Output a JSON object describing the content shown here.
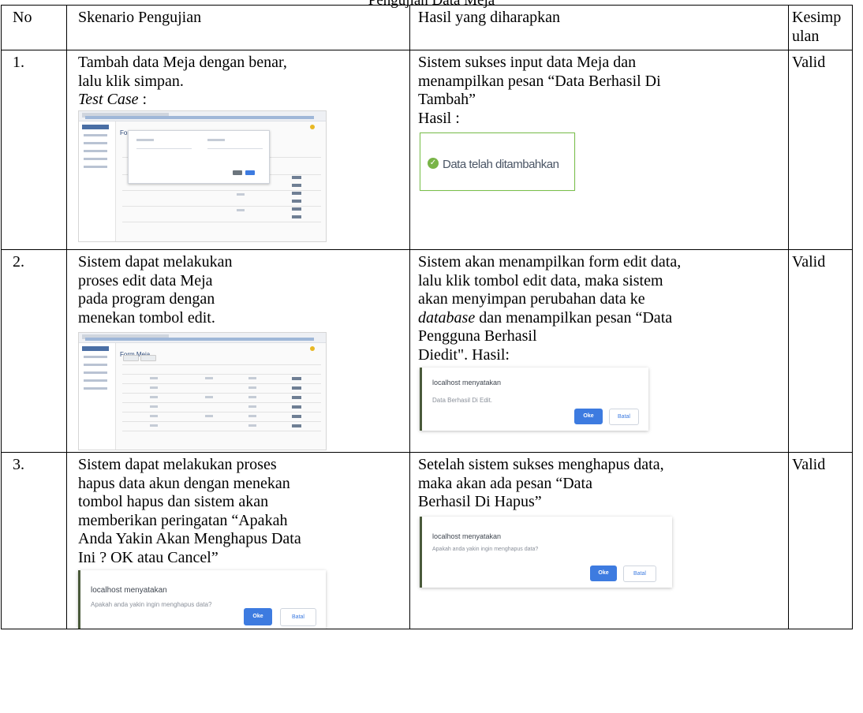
{
  "caption": "Pengujian Data Meja",
  "headers": {
    "no": "No",
    "skenario": "Skenario Pengujian",
    "hasil": "Hasil yang diharapkan",
    "kesimpulan_1": "Kesimp",
    "kesimpulan_2": "ulan"
  },
  "rows": [
    {
      "no": "1.",
      "skenario_lines": [
        "Tambah data Meja dengan benar,",
        "lalu klik simpan."
      ],
      "test_case_label": "Test Case",
      "test_case_suffix": " :",
      "hasil_lines": [
        "Sistem sukses input data Meja dan",
        "menampilkan pesan “Data Berhasil Di",
        "Tambah”",
        "Hasil :"
      ],
      "success_message": "Data telah ditambahkan",
      "screenshot_title": "Form Meja",
      "kesimpulan": "Valid"
    },
    {
      "no": "2.",
      "skenario_lines": [
        "Sistem dapat melakukan",
        "proses edit data Meja",
        "pada program dengan",
        "menekan tombol edit."
      ],
      "hasil_line1": "Sistem akan menampilkan form edit data,",
      "hasil_line2": "lalu klik tombol edit data, maka sistem",
      "hasil_line3": "akan menyimpan perubahan data ke",
      "hasil_db_word": "database",
      "hasil_line4_rest": " dan menampilkan pesan “Data",
      "hasil_line5": "Pengguna Berhasil",
      "hasil_line6": "Diedit\". Hasil:",
      "alert_title": "localhost menyatakan",
      "alert_message": "Data Berhasil Di Edit.",
      "alert_ok": "Oke",
      "alert_cancel": "Batal",
      "screenshot_title": "Form Meja",
      "kesimpulan": "Valid"
    },
    {
      "no": "3.",
      "skenario_lines": [
        "Sistem dapat melakukan proses",
        "hapus data akun dengan menekan",
        "tombol hapus dan sistem akan",
        "memberikan peringatan “Apakah",
        "Anda Yakin Akan Menghapus Data",
        "Ini ? OK atau Cancel”"
      ],
      "hasil_lines": [
        "Setelah sistem sukses menghapus data,",
        "maka akan ada pesan “Data",
        "Berhasil Di Hapus”"
      ],
      "alert_title": "localhost menyatakan",
      "alert_message": "Apakah anda yakin ingin menghapus data?",
      "alert_ok": "Oke",
      "alert_cancel": "Batal",
      "kesimpulan": "Valid"
    }
  ],
  "colors": {
    "ok_button": "#3d7be0",
    "success_border": "#7ac04b",
    "alert_accent": "#4a5a3a"
  }
}
